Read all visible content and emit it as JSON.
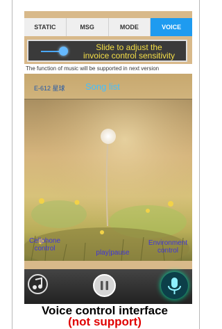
{
  "tabs": [
    {
      "label": "STATIC",
      "active": false
    },
    {
      "label": "MSG",
      "active": false
    },
    {
      "label": "MODE",
      "active": false
    },
    {
      "label": "VOICE",
      "active": true
    }
  ],
  "slider": {
    "text_line1": "Slide to adjust the",
    "text_line2": "invoice control sensitivity",
    "value": 0.15
  },
  "notice": "The function of music will be supported in next version",
  "info": {
    "device": "E-612 星球",
    "song_list": "Song list"
  },
  "labels": {
    "cellphone_line1": "Cellphone",
    "cellphone_line2": "control",
    "play_pause": "play|pause",
    "environment_line1": "Environment",
    "environment_line2": "control"
  },
  "controls": {
    "music_icon": "music-note-icon",
    "pause_icon": "pause-icon",
    "mic_icon": "microphone-icon"
  },
  "caption": {
    "line1": "Voice control interface",
    "line2": "(not support)"
  },
  "colors": {
    "accent": "#1e9bf0",
    "slider_text": "#f5df47",
    "label": "#3f35d8",
    "caption_warning": "#e00000"
  }
}
